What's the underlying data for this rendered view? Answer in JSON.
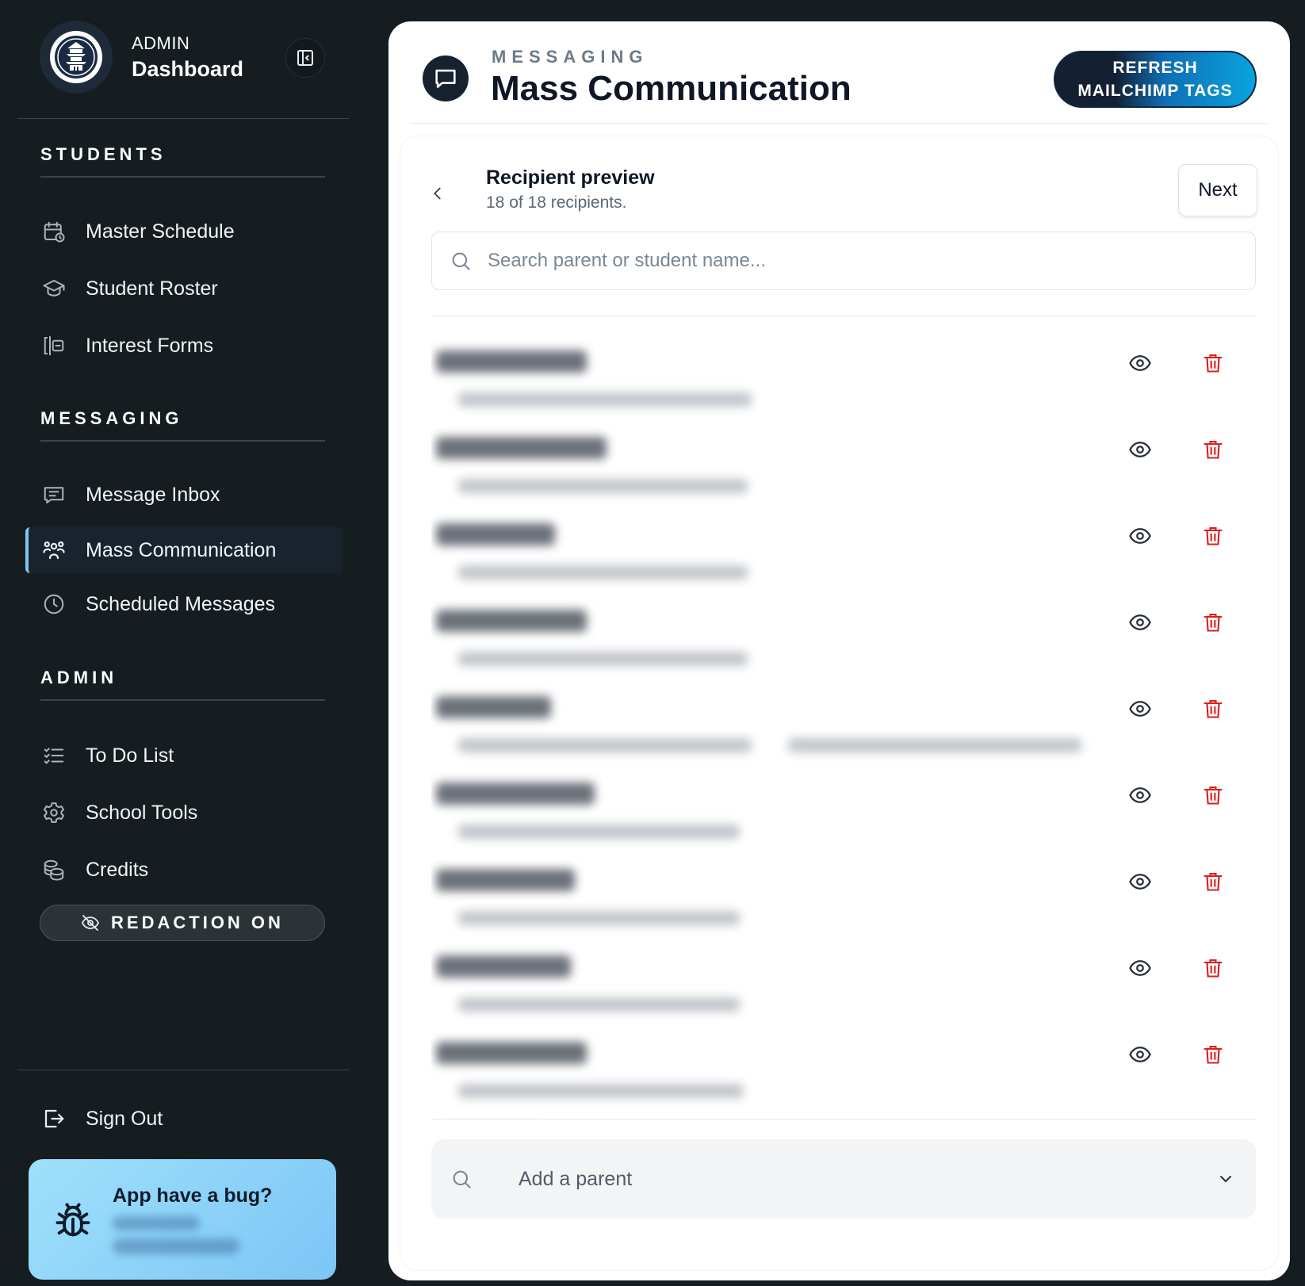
{
  "sidebar": {
    "brand": {
      "label_small": "ADMIN",
      "label_big": "Dashboard"
    },
    "sections": [
      {
        "title": "STUDENTS",
        "items": [
          {
            "label": "Master Schedule",
            "icon": "calendar-clock-icon"
          },
          {
            "label": "Student Roster",
            "icon": "graduation-cap-icon"
          },
          {
            "label": "Interest Forms",
            "icon": "form-input-icon"
          }
        ]
      },
      {
        "title": "MESSAGING",
        "items": [
          {
            "label": "Message Inbox",
            "icon": "message-square-icon"
          },
          {
            "label": "Mass Communication",
            "icon": "users-icon",
            "active": true
          },
          {
            "label": "Scheduled Messages",
            "icon": "clock-icon"
          }
        ]
      },
      {
        "title": "ADMIN",
        "items": [
          {
            "label": "To Do List",
            "icon": "list-checks-icon"
          },
          {
            "label": "School Tools",
            "icon": "gear-icon"
          },
          {
            "label": "Credits",
            "icon": "coins-icon"
          }
        ]
      }
    ],
    "redaction_label": "REDACTION ON",
    "sign_out_label": "Sign Out",
    "bug_card_title": "App have a bug?"
  },
  "header": {
    "eyebrow": "MESSAGING",
    "title": "Mass Communication",
    "refresh_line1": "REFRESH",
    "refresh_line2": "MAILCHIMP TAGS"
  },
  "preview": {
    "title": "Recipient preview",
    "subtitle": "18 of 18 recipients.",
    "next_label": "Next",
    "search_placeholder": "Search parent or student name...",
    "add_parent_placeholder": "Add a parent"
  },
  "theme": {
    "sidebar_bg": "#151d21",
    "accent": "#7cc8f0",
    "danger": "#e11d1d",
    "panel_bg": "#ffffff"
  }
}
